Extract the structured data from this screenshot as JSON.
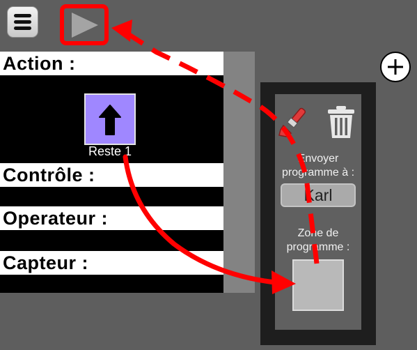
{
  "toolbar": {
    "menu_icon": "hamburger-menu-icon",
    "play_icon": "play-triangle-icon",
    "add_icon": "plus-circle-icon"
  },
  "palette": {
    "categories": [
      {
        "label": "Action :"
      },
      {
        "label": "Contrôle :"
      },
      {
        "label": "Operateur :"
      },
      {
        "label": "Capteur :"
      }
    ],
    "block": {
      "icon": "arrow-up-icon",
      "label": "Reste 1"
    }
  },
  "program_panel": {
    "brush_icon": "paint-brush-icon",
    "trash_icon": "trash-icon",
    "send_label": "Envoyer programme à :",
    "robot_name": "Karl",
    "zone_label": "Zone de programme :"
  },
  "colors": {
    "background": "#5e5e5e",
    "block_purple": "#9f87ff",
    "highlight_red": "#ff0000",
    "brush_red": "#e03a3a"
  }
}
